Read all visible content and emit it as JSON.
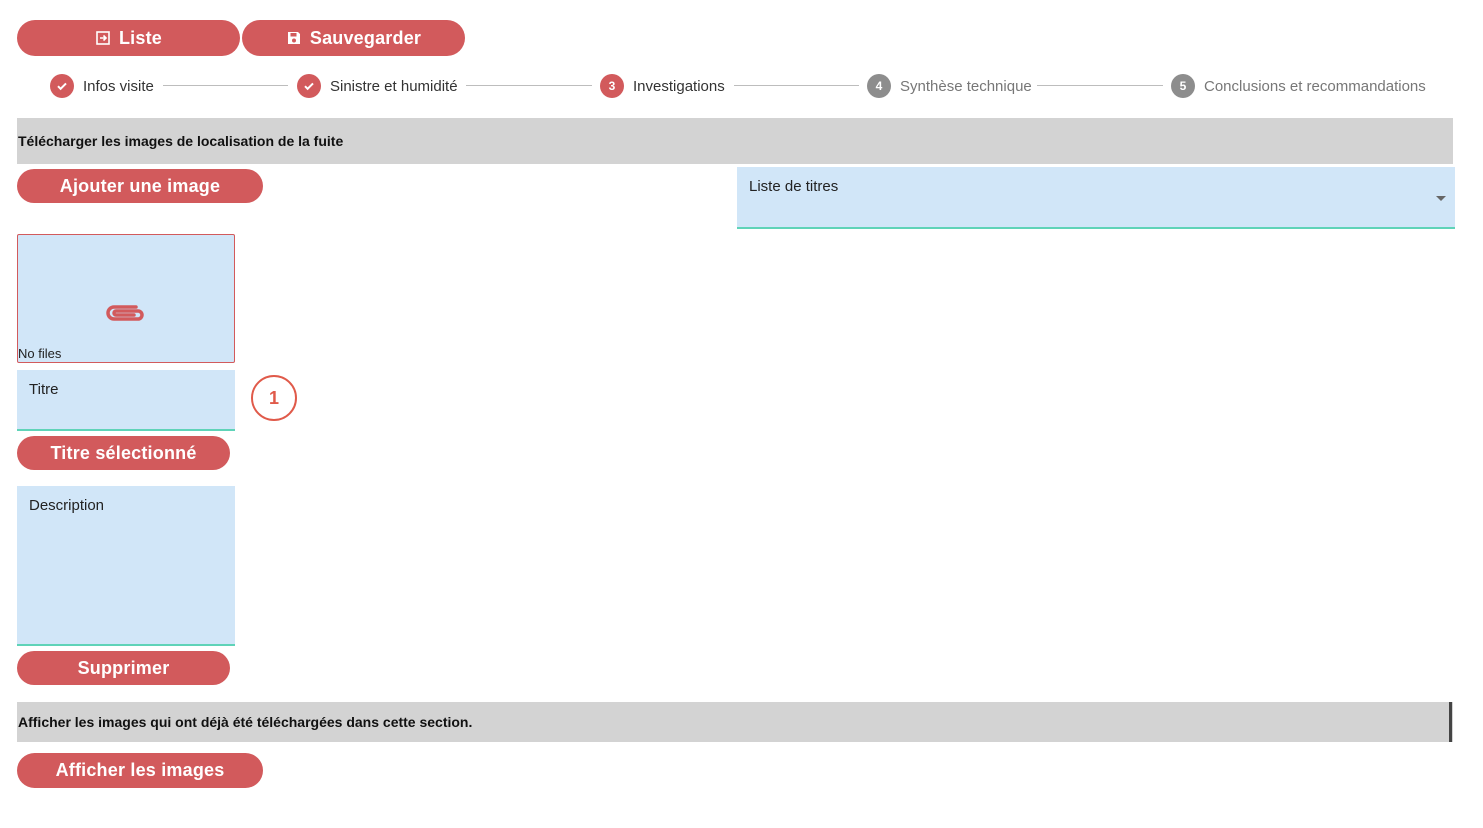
{
  "toolbar": {
    "list_label": "Liste",
    "save_label": "Sauvegarder"
  },
  "stepper": {
    "steps": [
      {
        "label": "Infos visite",
        "state": "done"
      },
      {
        "label": "Sinistre et humidité",
        "state": "done"
      },
      {
        "label": "Investigations",
        "state": "active",
        "number": "3"
      },
      {
        "label": "Synthèse technique",
        "state": "todo",
        "number": "4"
      },
      {
        "label": "Conclusions et recommandations",
        "state": "todo",
        "number": "5"
      }
    ]
  },
  "upload_section": {
    "header": "Télécharger les images de localisation de la fuite",
    "add_image_label": "Ajouter une image",
    "title_list_label": "Liste de titres",
    "dropzone_text": "No files",
    "title_field_label": "Titre",
    "selected_title_label": "Titre sélectionné",
    "description_label": "Description",
    "delete_label": "Supprimer",
    "badge_number": "1"
  },
  "gallery_section": {
    "header": "Afficher les images qui ont déjà été téléchargées dans cette section.",
    "show_images_label": "Afficher les images"
  },
  "colors": {
    "accent": "#d25a5c",
    "field_bg": "#d1e6f8",
    "field_underline": "#5fd3b8",
    "section_bar": "#d3d3d3",
    "inactive_step": "#8d8d8d"
  }
}
